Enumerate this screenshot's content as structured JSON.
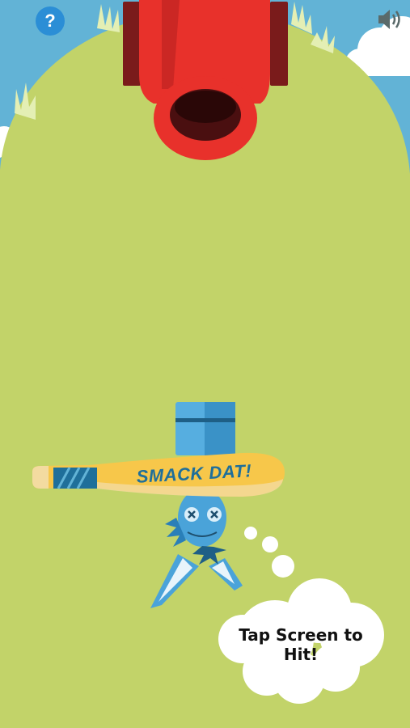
{
  "hud": {
    "help_label": "?",
    "sound_icon": "speaker-volume-icon"
  },
  "bat": {
    "label": "SMACK DAT!"
  },
  "hint": {
    "text": "Tap Screen to Hit!"
  },
  "colors": {
    "sky": "#62b3d6",
    "hill": "#c2d369",
    "cannon": "#e8312b",
    "cannon_dark": "#8c1d1a",
    "player": "#4aa3d9",
    "bat": "#f4b73a"
  }
}
